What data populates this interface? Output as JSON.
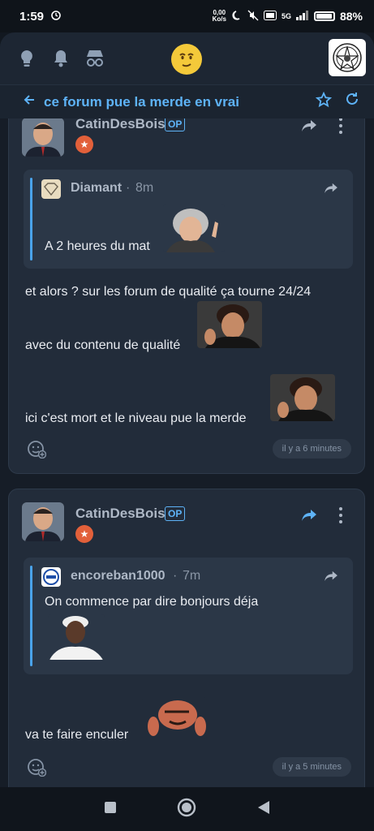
{
  "status": {
    "time": "1:59",
    "speed_top": "0,00",
    "speed_unit": "Ko/s",
    "signal": "5G",
    "battery_pct": "88%",
    "battery_level": 0.88
  },
  "topic": {
    "title": "ce forum pue la merde en vrai"
  },
  "posts": [
    {
      "author": "CatinDesBois",
      "op_badge": "OP",
      "quote": {
        "author": "Diamant",
        "time": "8m",
        "text": "A 2 heures du mat"
      },
      "lines": [
        "et alors ? sur les forum de qualité ça tourne 24/24",
        "avec du contenu de qualité",
        "ici c'est mort et le niveau pue la merde"
      ],
      "timestamp": "il y a 6 minutes"
    },
    {
      "author": "CatinDesBois",
      "op_badge": "OP",
      "quote": {
        "author": "encoreban1000",
        "time": "7m",
        "text": "On commence par dire bonjours déja"
      },
      "lines": [
        "va te faire enculer"
      ],
      "timestamp": "il y a 5 minutes"
    }
  ],
  "colors": {
    "accent": "#5eb3f7",
    "background": "#161d27",
    "card": "#222c3a",
    "rank_badge": "#e2603a"
  }
}
